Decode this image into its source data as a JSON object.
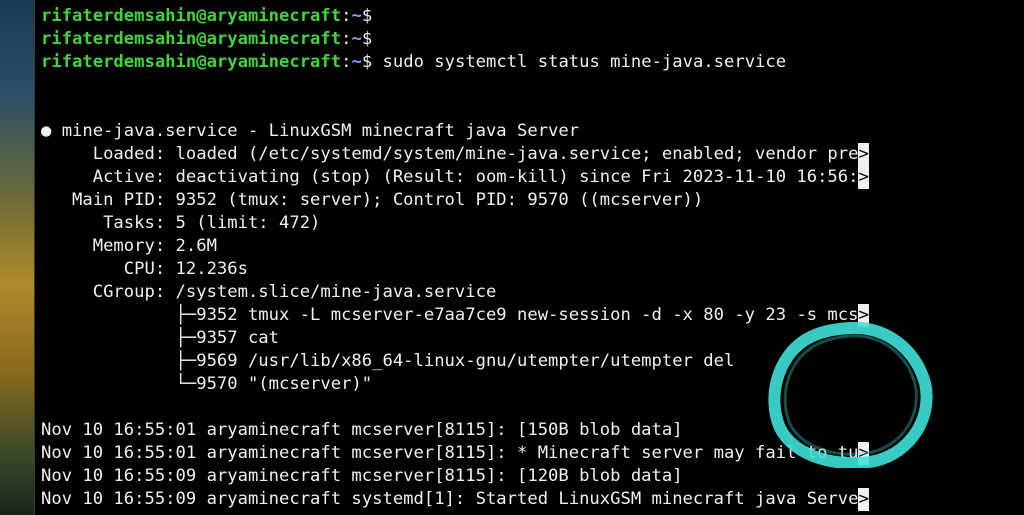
{
  "colors": {
    "user": "#41d33a",
    "path": "#7aa8ff",
    "text": "#f0f0f0",
    "ring": "#3fe0d8"
  },
  "prompt": {
    "user_host": "rifaterdemsahin@aryaminecraft",
    "colon": ":",
    "path": "~",
    "symbol": "$"
  },
  "command": "sudo systemctl status mine-java.service",
  "status": {
    "header": "● mine-java.service - LinuxGSM minecraft java Server",
    "loaded": "     Loaded: loaded (/etc/systemd/system/mine-java.service; enabled; vendor pre",
    "active": "     Active: deactivating (stop) (Result: oom-kill) since Fri 2023-11-10 16:56:",
    "main_pid": "   Main PID: 9352 (tmux: server); Control PID: 9570 ((mcserver))",
    "tasks": "      Tasks: 5 (limit: 472)",
    "memory": "     Memory: 2.6M",
    "cpu": "        CPU: 12.236s",
    "cgroup": "     CGroup: /system.slice/mine-java.service",
    "tree": [
      "             ├─9352 tmux -L mcserver-e7aa7ce9 new-session -d -x 80 -y 23 -s mcs",
      "             ├─9357 cat",
      "             ├─9569 /usr/lib/x86_64-linux-gnu/utempter/utempter del",
      "             └─9570 \"(mcserver)\""
    ]
  },
  "logs": [
    "Nov 10 16:55:01 aryaminecraft mcserver[8115]: [150B blob data]",
    "Nov 10 16:55:01 aryaminecraft mcserver[8115]: * Minecraft server may fail to tu",
    "Nov 10 16:55:09 aryaminecraft mcserver[8115]: [120B blob data]",
    "Nov 10 16:55:09 aryaminecraft systemd[1]: Started LinuxGSM minecraft java Serve"
  ],
  "truncation_marker": ">"
}
